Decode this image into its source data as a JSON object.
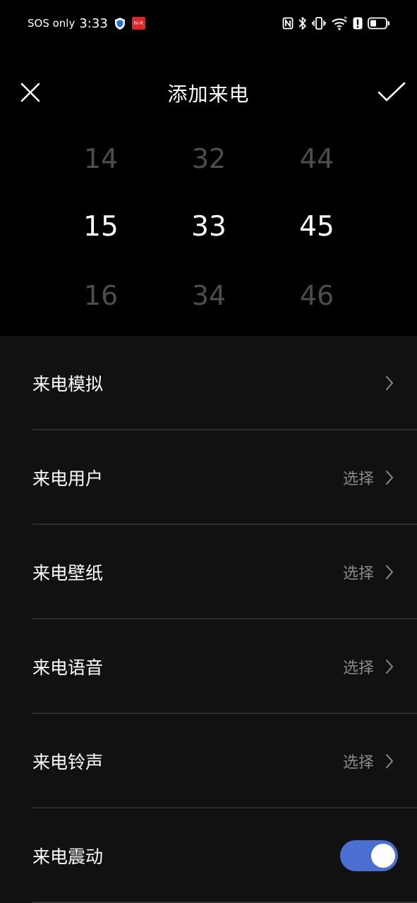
{
  "status_bar": {
    "sos": "SOS only",
    "time": "3:33",
    "app_icon_text": "hi·R"
  },
  "header": {
    "title": "添加来电",
    "close_icon": "close-icon",
    "confirm_icon": "check-icon"
  },
  "picker": {
    "hour": {
      "prev": "14",
      "current": "15",
      "next": "16"
    },
    "minute": {
      "prev": "32",
      "current": "33",
      "next": "34"
    },
    "second": {
      "prev": "44",
      "current": "45",
      "next": "46"
    }
  },
  "settings": {
    "items": [
      {
        "label": "来电模拟",
        "value": ""
      },
      {
        "label": "来电用户",
        "value": "选择"
      },
      {
        "label": "来电壁纸",
        "value": "选择"
      },
      {
        "label": "来电语音",
        "value": "选择"
      },
      {
        "label": "来电铃声",
        "value": "选择"
      },
      {
        "label": "来电震动",
        "toggle_on": true
      }
    ]
  },
  "colors": {
    "background": "#000000",
    "list_background": "#111111",
    "toggle_on": "#4a6fd0",
    "secondary_text": "#8a8a8a"
  }
}
